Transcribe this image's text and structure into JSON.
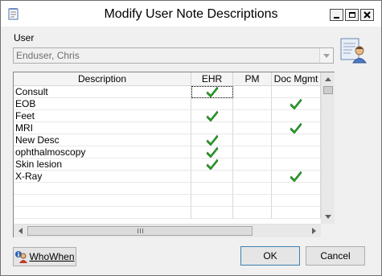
{
  "window": {
    "title": "Modify User Note Descriptions"
  },
  "user": {
    "label": "User",
    "value": "Enduser, Chris"
  },
  "grid": {
    "columns": [
      "Description",
      "EHR",
      "PM",
      "Doc Mgmt"
    ],
    "rows": [
      {
        "description": "Consult",
        "ehr": true,
        "pm": false,
        "doc": false
      },
      {
        "description": "EOB",
        "ehr": false,
        "pm": false,
        "doc": true
      },
      {
        "description": "Feet",
        "ehr": true,
        "pm": false,
        "doc": false
      },
      {
        "description": "MRI",
        "ehr": false,
        "pm": false,
        "doc": true
      },
      {
        "description": "New Desc",
        "ehr": true,
        "pm": false,
        "doc": false
      },
      {
        "description": "ophthalmoscopy",
        "ehr": true,
        "pm": false,
        "doc": false
      },
      {
        "description": "Skin lesion",
        "ehr": true,
        "pm": false,
        "doc": false
      },
      {
        "description": "X-Ray",
        "ehr": false,
        "pm": false,
        "doc": true
      }
    ],
    "empty_rows": 3,
    "check_color": "#2aa52a"
  },
  "buttons": {
    "who_when": "WhoWhen",
    "ok": "OK",
    "cancel": "Cancel"
  },
  "icons": {
    "title": "notepad-icon",
    "user": "user-card-icon",
    "check": "checkmark-icon",
    "who": "info-person-icon"
  }
}
